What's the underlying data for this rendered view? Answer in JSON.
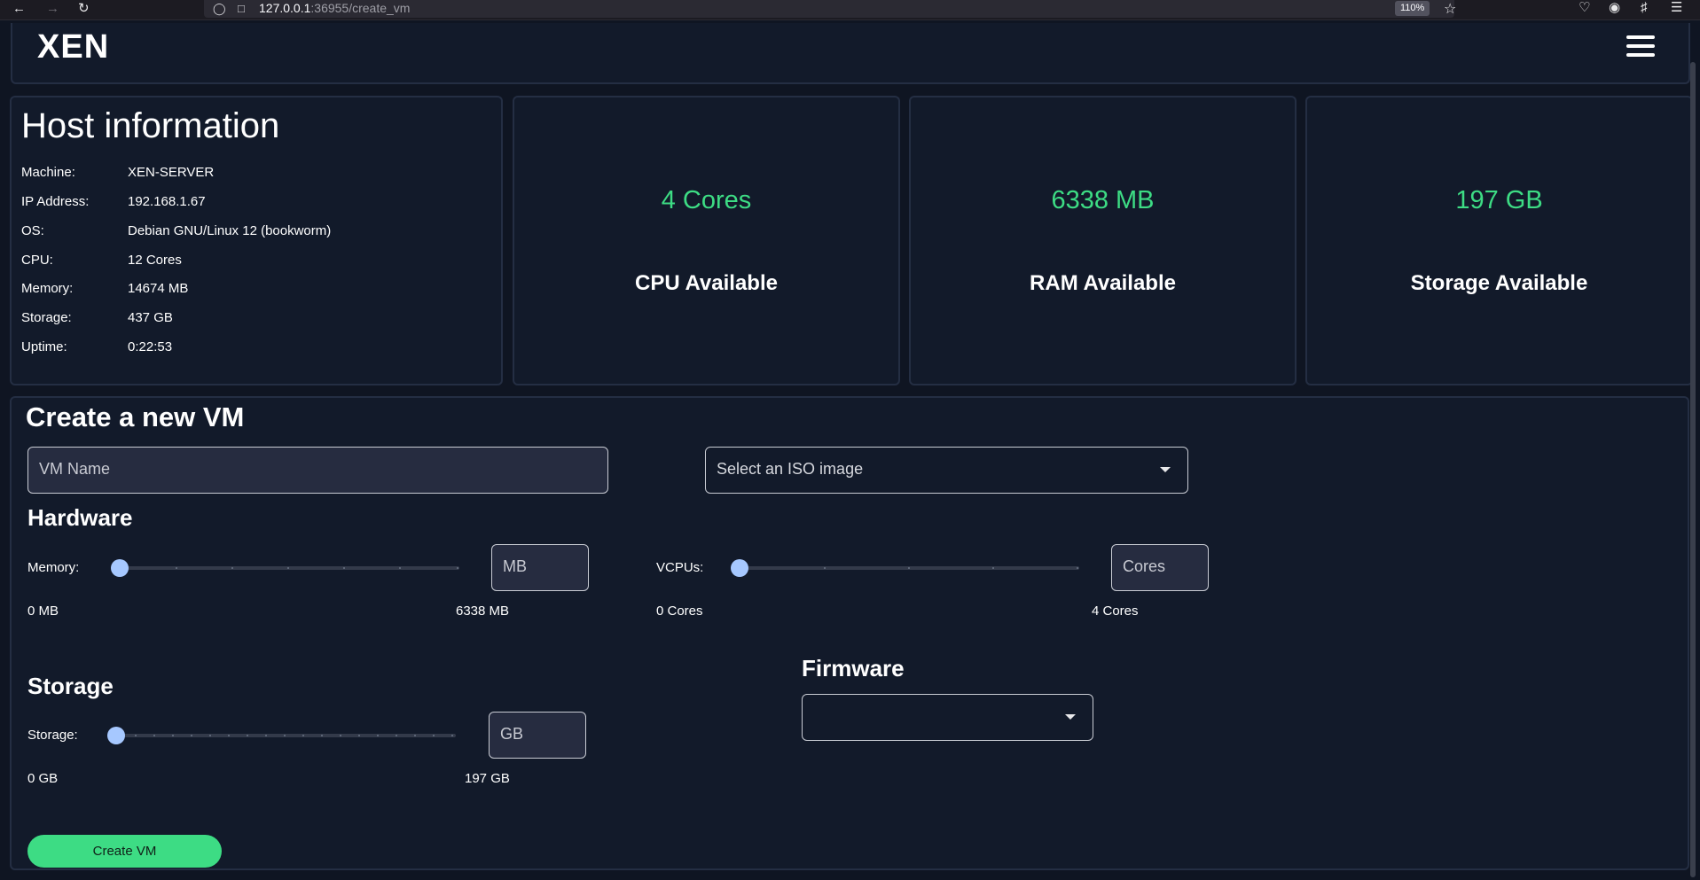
{
  "browser": {
    "url_host": "127.0.0.1",
    "url_path": ":36955/create_vm",
    "zoom": "110%"
  },
  "app": {
    "logo": "XEN"
  },
  "host_info": {
    "title": "Host information",
    "rows": [
      {
        "key": "Machine:",
        "value": "XEN-SERVER"
      },
      {
        "key": "IP Address:",
        "value": "192.168.1.67"
      },
      {
        "key": "OS:",
        "value": "Debian GNU/Linux 12 (bookworm)"
      },
      {
        "key": "CPU:",
        "value": "12 Cores"
      },
      {
        "key": "Memory:",
        "value": "14674 MB"
      },
      {
        "key": "Storage:",
        "value": "437 GB"
      },
      {
        "key": "Uptime:",
        "value": "0:22:53"
      }
    ]
  },
  "stats": {
    "cpu": {
      "value": "4 Cores",
      "label": "CPU Available"
    },
    "ram": {
      "value": "6338 MB",
      "label": "RAM Available"
    },
    "storage": {
      "value": "197 GB",
      "label": "Storage Available"
    }
  },
  "create": {
    "title": "Create a new VM",
    "vm_name_placeholder": "VM Name",
    "iso_select": "Select an ISO image",
    "hardware_title": "Hardware",
    "memory": {
      "label": "Memory:",
      "min": "0 MB",
      "max": "6338 MB",
      "unit_placeholder": "MB",
      "level": 0
    },
    "vcpus": {
      "label": "VCPUs:",
      "min": "0 Cores",
      "max": "4 Cores",
      "unit_placeholder": "Cores",
      "level": 0
    },
    "storage_title": "Storage",
    "storage": {
      "label": "Storage:",
      "min": "0 GB",
      "max": "197 GB",
      "unit_placeholder": "GB",
      "level": 0
    },
    "firmware_title": "Firmware",
    "firmware_value": "",
    "submit_label": "Create VM"
  },
  "colors": {
    "accent": "#3ddc84",
    "background": "#0f1522",
    "card": "#121a2a",
    "slider_thumb": "#a6c8ff"
  }
}
